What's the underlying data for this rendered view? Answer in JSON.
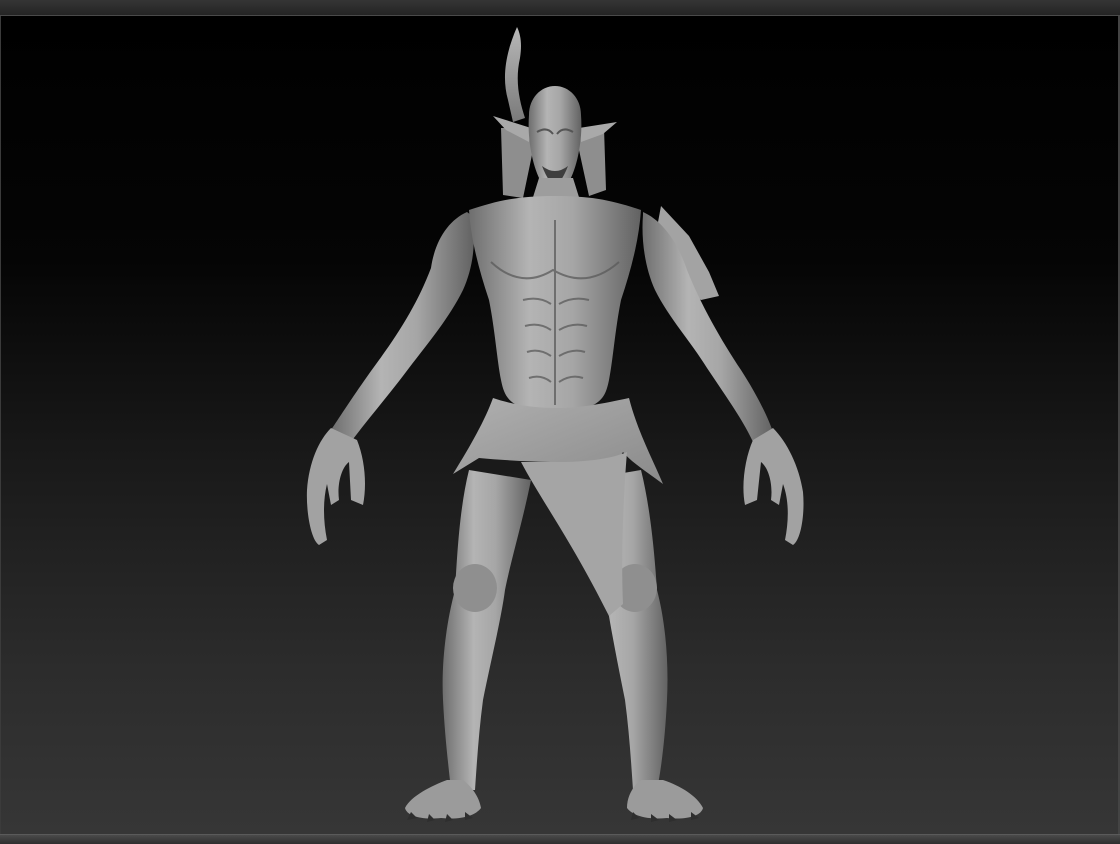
{
  "viewport": {
    "subject": "demon-sculpt",
    "colors": {
      "background_top": "#000000",
      "background_bottom": "#363636",
      "clay_light": "#b9b9b9",
      "clay_mid": "#8c8c8c",
      "clay_dark": "#4a4a4a"
    }
  }
}
